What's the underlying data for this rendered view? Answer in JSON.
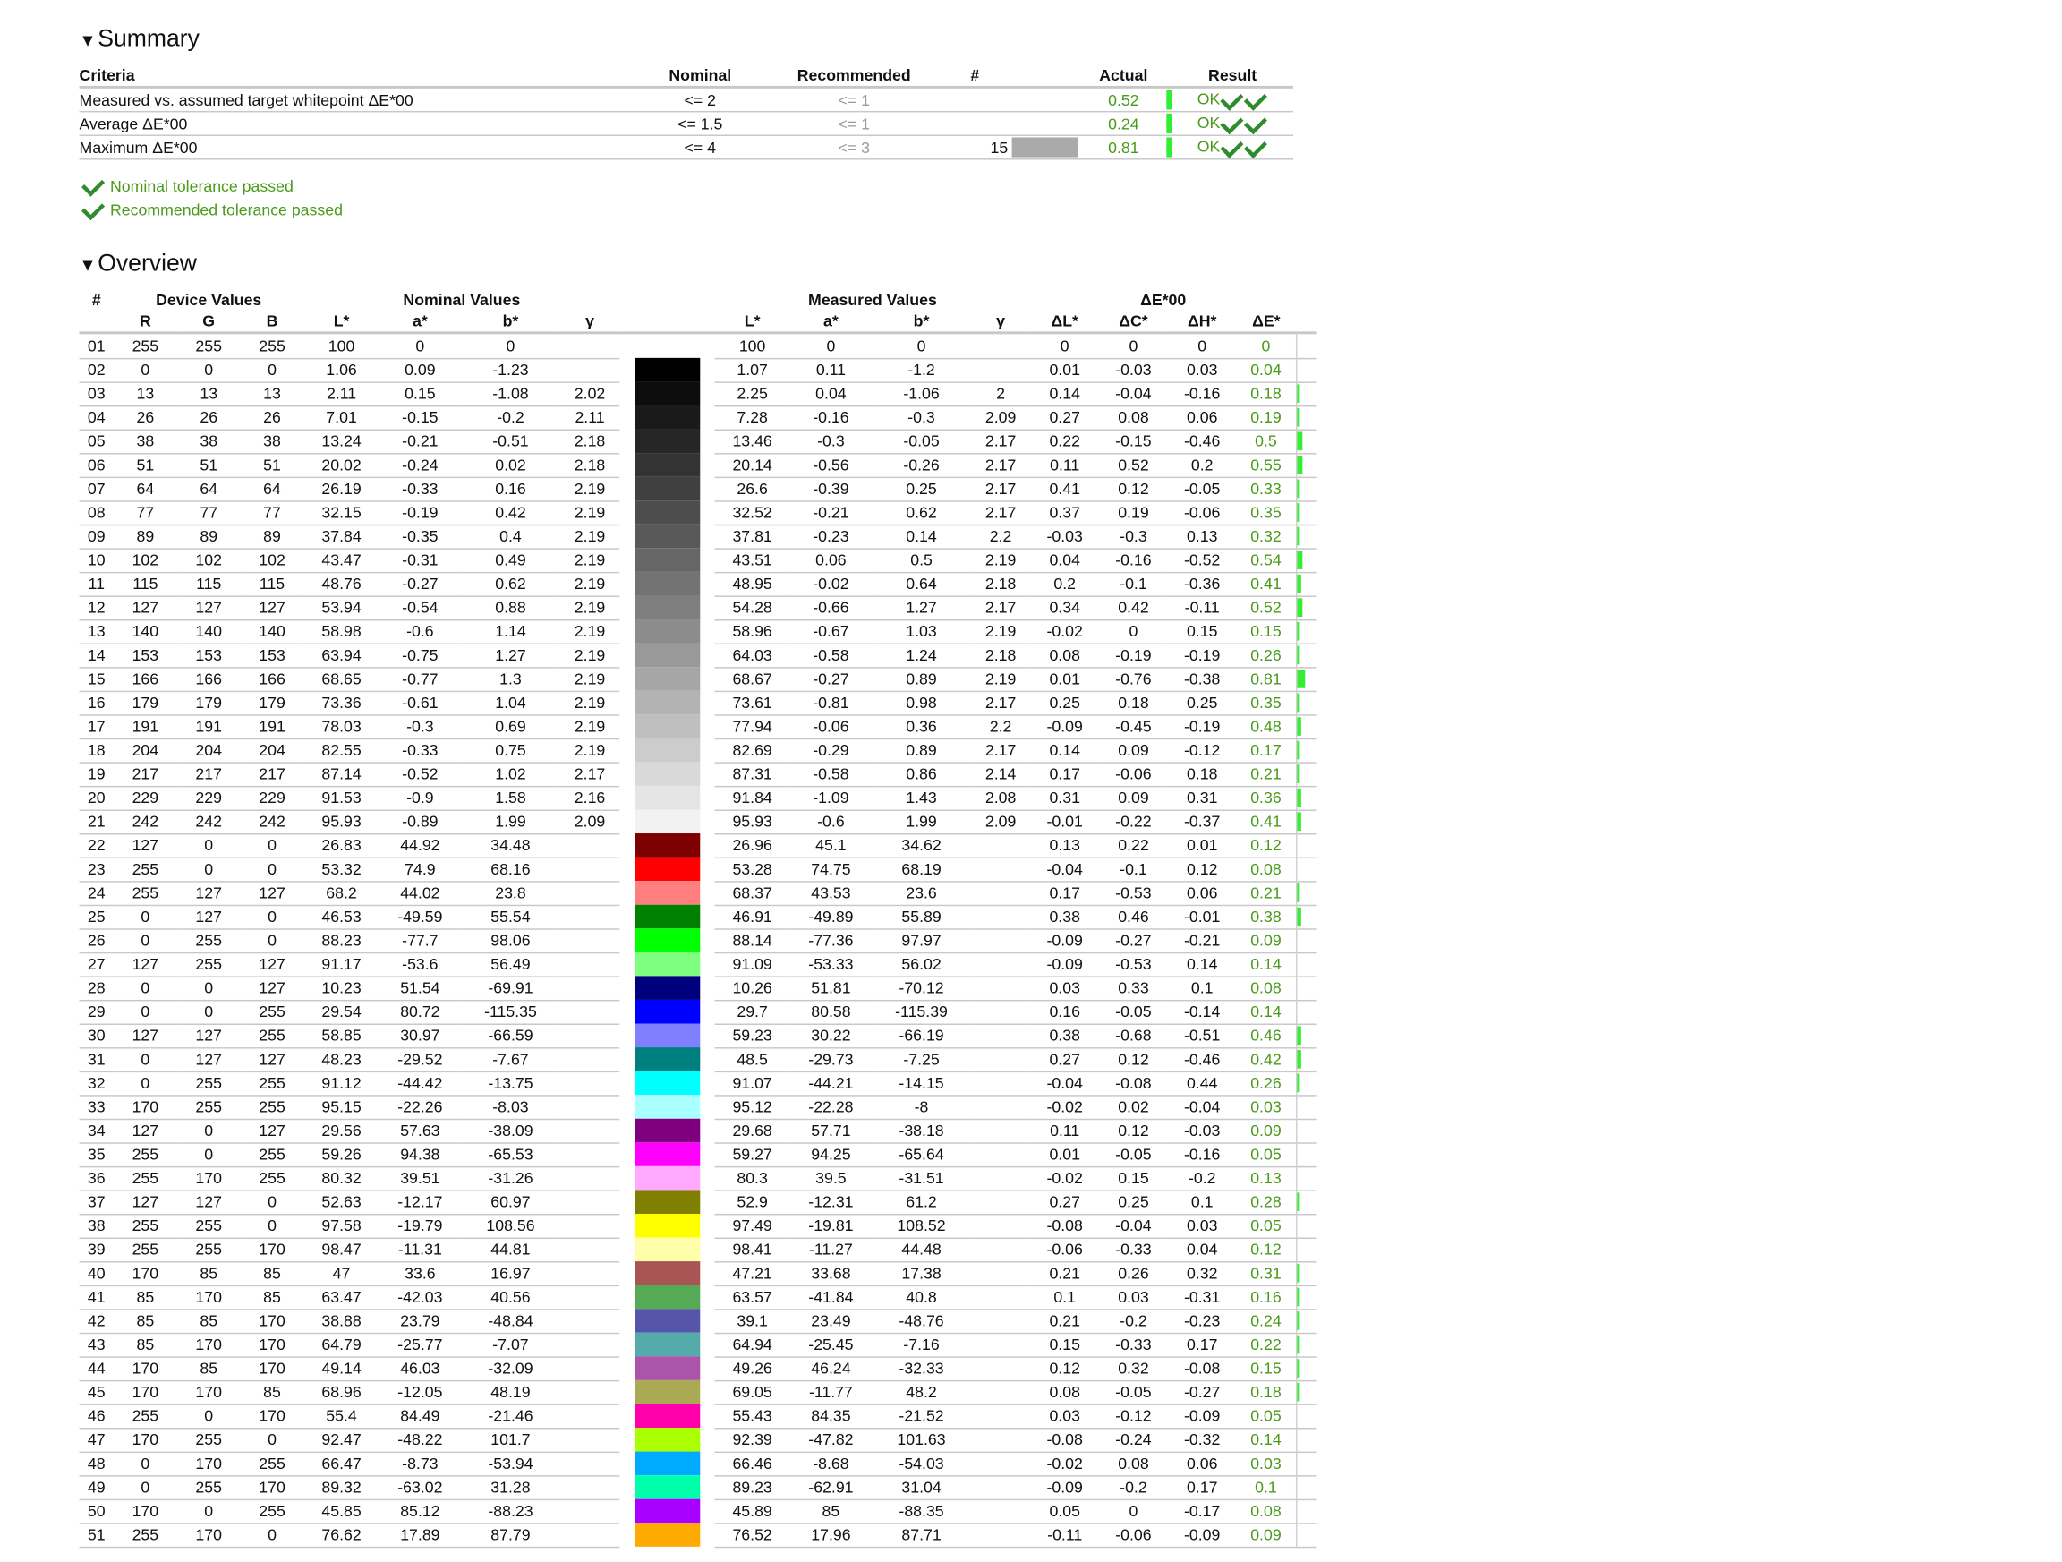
{
  "summary": {
    "title": "Summary",
    "headers": {
      "criteria": "Criteria",
      "nominal": "Nominal",
      "recommended": "Recommended",
      "count": "#",
      "actual": "Actual",
      "result": "Result"
    },
    "rows": [
      {
        "criteria": "Measured vs. assumed target whitepoint ΔE*00",
        "nominal": "<= 2",
        "recommended": "<= 1",
        "count": "",
        "swatch": "",
        "actual": "0.52",
        "bar": 0.52,
        "result": "OK"
      },
      {
        "criteria": "Average ΔE*00",
        "nominal": "<= 1.5",
        "recommended": "<= 1",
        "count": "",
        "swatch": "",
        "actual": "0.24",
        "bar": 0.24,
        "result": "OK"
      },
      {
        "criteria": "Maximum ΔE*00",
        "nominal": "<= 4",
        "recommended": "<= 3",
        "count": "15",
        "swatch": "#aaaaaa",
        "actual": "0.81",
        "bar": 0.81,
        "result": "OK"
      }
    ],
    "passed": [
      "Nominal tolerance passed",
      "Recommended tolerance passed"
    ]
  },
  "overview": {
    "title": "Overview",
    "groups": {
      "num": "#",
      "device": "Device Values",
      "nominal": "Nominal Values",
      "measured": "Measured Values",
      "delta": "ΔE*00"
    },
    "columns": [
      "R",
      "G",
      "B",
      "L*",
      "a*",
      "b*",
      "γ",
      "L*",
      "a*",
      "b*",
      "γ",
      "ΔL*",
      "ΔC*",
      "ΔH*",
      "ΔE*"
    ],
    "rows": [
      [
        "01",
        "255",
        "255",
        "255",
        "100",
        "0",
        "0",
        "",
        "#ffffff",
        "100",
        "0",
        "0",
        "",
        "0",
        "0",
        "0",
        "0"
      ],
      [
        "02",
        "0",
        "0",
        "0",
        "1.06",
        "0.09",
        "-1.23",
        "",
        "#000000",
        "1.07",
        "0.11",
        "-1.2",
        "",
        "0.01",
        "-0.03",
        "0.03",
        "0.04"
      ],
      [
        "03",
        "13",
        "13",
        "13",
        "2.11",
        "0.15",
        "-1.08",
        "2.02",
        "#0d0d0d",
        "2.25",
        "0.04",
        "-1.06",
        "2",
        "0.14",
        "-0.04",
        "-0.16",
        "0.18"
      ],
      [
        "04",
        "26",
        "26",
        "26",
        "7.01",
        "-0.15",
        "-0.2",
        "2.11",
        "#1a1a1a",
        "7.28",
        "-0.16",
        "-0.3",
        "2.09",
        "0.27",
        "0.08",
        "0.06",
        "0.19"
      ],
      [
        "05",
        "38",
        "38",
        "38",
        "13.24",
        "-0.21",
        "-0.51",
        "2.18",
        "#262626",
        "13.46",
        "-0.3",
        "-0.05",
        "2.17",
        "0.22",
        "-0.15",
        "-0.46",
        "0.5"
      ],
      [
        "06",
        "51",
        "51",
        "51",
        "20.02",
        "-0.24",
        "0.02",
        "2.18",
        "#333333",
        "20.14",
        "-0.56",
        "-0.26",
        "2.17",
        "0.11",
        "0.52",
        "0.2",
        "0.55"
      ],
      [
        "07",
        "64",
        "64",
        "64",
        "26.19",
        "-0.33",
        "0.16",
        "2.19",
        "#404040",
        "26.6",
        "-0.39",
        "0.25",
        "2.17",
        "0.41",
        "0.12",
        "-0.05",
        "0.33"
      ],
      [
        "08",
        "77",
        "77",
        "77",
        "32.15",
        "-0.19",
        "0.42",
        "2.19",
        "#4d4d4d",
        "32.52",
        "-0.21",
        "0.62",
        "2.17",
        "0.37",
        "0.19",
        "-0.06",
        "0.35"
      ],
      [
        "09",
        "89",
        "89",
        "89",
        "37.84",
        "-0.35",
        "0.4",
        "2.19",
        "#595959",
        "37.81",
        "-0.23",
        "0.14",
        "2.2",
        "-0.03",
        "-0.3",
        "0.13",
        "0.32"
      ],
      [
        "10",
        "102",
        "102",
        "102",
        "43.47",
        "-0.31",
        "0.49",
        "2.19",
        "#666666",
        "43.51",
        "0.06",
        "0.5",
        "2.19",
        "0.04",
        "-0.16",
        "-0.52",
        "0.54"
      ],
      [
        "11",
        "115",
        "115",
        "115",
        "48.76",
        "-0.27",
        "0.62",
        "2.19",
        "#737373",
        "48.95",
        "-0.02",
        "0.64",
        "2.18",
        "0.2",
        "-0.1",
        "-0.36",
        "0.41"
      ],
      [
        "12",
        "127",
        "127",
        "127",
        "53.94",
        "-0.54",
        "0.88",
        "2.19",
        "#7f7f7f",
        "54.28",
        "-0.66",
        "1.27",
        "2.17",
        "0.34",
        "0.42",
        "-0.11",
        "0.52"
      ],
      [
        "13",
        "140",
        "140",
        "140",
        "58.98",
        "-0.6",
        "1.14",
        "2.19",
        "#8c8c8c",
        "58.96",
        "-0.67",
        "1.03",
        "2.19",
        "-0.02",
        "0",
        "0.15",
        "0.15"
      ],
      [
        "14",
        "153",
        "153",
        "153",
        "63.94",
        "-0.75",
        "1.27",
        "2.19",
        "#999999",
        "64.03",
        "-0.58",
        "1.24",
        "2.18",
        "0.08",
        "-0.19",
        "-0.19",
        "0.26"
      ],
      [
        "15",
        "166",
        "166",
        "166",
        "68.65",
        "-0.77",
        "1.3",
        "2.19",
        "#a6a6a6",
        "68.67",
        "-0.27",
        "0.89",
        "2.19",
        "0.01",
        "-0.76",
        "-0.38",
        "0.81"
      ],
      [
        "16",
        "179",
        "179",
        "179",
        "73.36",
        "-0.61",
        "1.04",
        "2.19",
        "#b3b3b3",
        "73.61",
        "-0.81",
        "0.98",
        "2.17",
        "0.25",
        "0.18",
        "0.25",
        "0.35"
      ],
      [
        "17",
        "191",
        "191",
        "191",
        "78.03",
        "-0.3",
        "0.69",
        "2.19",
        "#bfbfbf",
        "77.94",
        "-0.06",
        "0.36",
        "2.2",
        "-0.09",
        "-0.45",
        "-0.19",
        "0.48"
      ],
      [
        "18",
        "204",
        "204",
        "204",
        "82.55",
        "-0.33",
        "0.75",
        "2.19",
        "#cccccc",
        "82.69",
        "-0.29",
        "0.89",
        "2.17",
        "0.14",
        "0.09",
        "-0.12",
        "0.17"
      ],
      [
        "19",
        "217",
        "217",
        "217",
        "87.14",
        "-0.52",
        "1.02",
        "2.17",
        "#d9d9d9",
        "87.31",
        "-0.58",
        "0.86",
        "2.14",
        "0.17",
        "-0.06",
        "0.18",
        "0.21"
      ],
      [
        "20",
        "229",
        "229",
        "229",
        "91.53",
        "-0.9",
        "1.58",
        "2.16",
        "#e5e5e5",
        "91.84",
        "-1.09",
        "1.43",
        "2.08",
        "0.31",
        "0.09",
        "0.31",
        "0.36"
      ],
      [
        "21",
        "242",
        "242",
        "242",
        "95.93",
        "-0.89",
        "1.99",
        "2.09",
        "#f2f2f2",
        "95.93",
        "-0.6",
        "1.99",
        "2.09",
        "-0.01",
        "-0.22",
        "-0.37",
        "0.41"
      ],
      [
        "22",
        "127",
        "0",
        "0",
        "26.83",
        "44.92",
        "34.48",
        "",
        "#7f0000",
        "26.96",
        "45.1",
        "34.62",
        "",
        "0.13",
        "0.22",
        "0.01",
        "0.12"
      ],
      [
        "23",
        "255",
        "0",
        "0",
        "53.32",
        "74.9",
        "68.16",
        "",
        "#ff0000",
        "53.28",
        "74.75",
        "68.19",
        "",
        "-0.04",
        "-0.1",
        "0.12",
        "0.08"
      ],
      [
        "24",
        "255",
        "127",
        "127",
        "68.2",
        "44.02",
        "23.8",
        "",
        "#ff7f7f",
        "68.37",
        "43.53",
        "23.6",
        "",
        "0.17",
        "-0.53",
        "0.06",
        "0.21"
      ],
      [
        "25",
        "0",
        "127",
        "0",
        "46.53",
        "-49.59",
        "55.54",
        "",
        "#007f00",
        "46.91",
        "-49.89",
        "55.89",
        "",
        "0.38",
        "0.46",
        "-0.01",
        "0.38"
      ],
      [
        "26",
        "0",
        "255",
        "0",
        "88.23",
        "-77.7",
        "98.06",
        "",
        "#00ff00",
        "88.14",
        "-77.36",
        "97.97",
        "",
        "-0.09",
        "-0.27",
        "-0.21",
        "0.09"
      ],
      [
        "27",
        "127",
        "255",
        "127",
        "91.17",
        "-53.6",
        "56.49",
        "",
        "#7fff7f",
        "91.09",
        "-53.33",
        "56.02",
        "",
        "-0.09",
        "-0.53",
        "0.14",
        "0.14"
      ],
      [
        "28",
        "0",
        "0",
        "127",
        "10.23",
        "51.54",
        "-69.91",
        "",
        "#00007f",
        "10.26",
        "51.81",
        "-70.12",
        "",
        "0.03",
        "0.33",
        "0.1",
        "0.08"
      ],
      [
        "29",
        "0",
        "0",
        "255",
        "29.54",
        "80.72",
        "-115.35",
        "",
        "#0000ff",
        "29.7",
        "80.58",
        "-115.39",
        "",
        "0.16",
        "-0.05",
        "-0.14",
        "0.14"
      ],
      [
        "30",
        "127",
        "127",
        "255",
        "58.85",
        "30.97",
        "-66.59",
        "",
        "#7f7fff",
        "59.23",
        "30.22",
        "-66.19",
        "",
        "0.38",
        "-0.68",
        "-0.51",
        "0.46"
      ],
      [
        "31",
        "0",
        "127",
        "127",
        "48.23",
        "-29.52",
        "-7.67",
        "",
        "#007f7f",
        "48.5",
        "-29.73",
        "-7.25",
        "",
        "0.27",
        "0.12",
        "-0.46",
        "0.42"
      ],
      [
        "32",
        "0",
        "255",
        "255",
        "91.12",
        "-44.42",
        "-13.75",
        "",
        "#00ffff",
        "91.07",
        "-44.21",
        "-14.15",
        "",
        "-0.04",
        "-0.08",
        "0.44",
        "0.26"
      ],
      [
        "33",
        "170",
        "255",
        "255",
        "95.15",
        "-22.26",
        "-8.03",
        "",
        "#aaffff",
        "95.12",
        "-22.28",
        "-8",
        "",
        "-0.02",
        "0.02",
        "-0.04",
        "0.03"
      ],
      [
        "34",
        "127",
        "0",
        "127",
        "29.56",
        "57.63",
        "-38.09",
        "",
        "#7f007f",
        "29.68",
        "57.71",
        "-38.18",
        "",
        "0.11",
        "0.12",
        "-0.03",
        "0.09"
      ],
      [
        "35",
        "255",
        "0",
        "255",
        "59.26",
        "94.38",
        "-65.53",
        "",
        "#ff00ff",
        "59.27",
        "94.25",
        "-65.64",
        "",
        "0.01",
        "-0.05",
        "-0.16",
        "0.05"
      ],
      [
        "36",
        "255",
        "170",
        "255",
        "80.32",
        "39.51",
        "-31.26",
        "",
        "#ffaaff",
        "80.3",
        "39.5",
        "-31.51",
        "",
        "-0.02",
        "0.15",
        "-0.2",
        "0.13"
      ],
      [
        "37",
        "127",
        "127",
        "0",
        "52.63",
        "-12.17",
        "60.97",
        "",
        "#7f7f00",
        "52.9",
        "-12.31",
        "61.2",
        "",
        "0.27",
        "0.25",
        "0.1",
        "0.28"
      ],
      [
        "38",
        "255",
        "255",
        "0",
        "97.58",
        "-19.79",
        "108.56",
        "",
        "#ffff00",
        "97.49",
        "-19.81",
        "108.52",
        "",
        "-0.08",
        "-0.04",
        "0.03",
        "0.05"
      ],
      [
        "39",
        "255",
        "255",
        "170",
        "98.47",
        "-11.31",
        "44.81",
        "",
        "#ffffaa",
        "98.41",
        "-11.27",
        "44.48",
        "",
        "-0.06",
        "-0.33",
        "0.04",
        "0.12"
      ],
      [
        "40",
        "170",
        "85",
        "85",
        "47",
        "33.6",
        "16.97",
        "",
        "#aa5555",
        "47.21",
        "33.68",
        "17.38",
        "",
        "0.21",
        "0.26",
        "0.32",
        "0.31"
      ],
      [
        "41",
        "85",
        "170",
        "85",
        "63.47",
        "-42.03",
        "40.56",
        "",
        "#55aa55",
        "63.57",
        "-41.84",
        "40.8",
        "",
        "0.1",
        "0.03",
        "-0.31",
        "0.16"
      ],
      [
        "42",
        "85",
        "85",
        "170",
        "38.88",
        "23.79",
        "-48.84",
        "",
        "#5555aa",
        "39.1",
        "23.49",
        "-48.76",
        "",
        "0.21",
        "-0.2",
        "-0.23",
        "0.24"
      ],
      [
        "43",
        "85",
        "170",
        "170",
        "64.79",
        "-25.77",
        "-7.07",
        "",
        "#55aaaa",
        "64.94",
        "-25.45",
        "-7.16",
        "",
        "0.15",
        "-0.33",
        "0.17",
        "0.22"
      ],
      [
        "44",
        "170",
        "85",
        "170",
        "49.14",
        "46.03",
        "-32.09",
        "",
        "#aa55aa",
        "49.26",
        "46.24",
        "-32.33",
        "",
        "0.12",
        "0.32",
        "-0.08",
        "0.15"
      ],
      [
        "45",
        "170",
        "170",
        "85",
        "68.96",
        "-12.05",
        "48.19",
        "",
        "#aaaa55",
        "69.05",
        "-11.77",
        "48.2",
        "",
        "0.08",
        "-0.05",
        "-0.27",
        "0.18"
      ],
      [
        "46",
        "255",
        "0",
        "170",
        "55.4",
        "84.49",
        "-21.46",
        "",
        "#ff00aa",
        "55.43",
        "84.35",
        "-21.52",
        "",
        "0.03",
        "-0.12",
        "-0.09",
        "0.05"
      ],
      [
        "47",
        "170",
        "255",
        "0",
        "92.47",
        "-48.22",
        "101.7",
        "",
        "#aaff00",
        "92.39",
        "-47.82",
        "101.63",
        "",
        "-0.08",
        "-0.24",
        "-0.32",
        "0.14"
      ],
      [
        "48",
        "0",
        "170",
        "255",
        "66.47",
        "-8.73",
        "-53.94",
        "",
        "#00aaff",
        "66.46",
        "-8.68",
        "-54.03",
        "",
        "-0.02",
        "0.08",
        "0.06",
        "0.03"
      ],
      [
        "49",
        "0",
        "255",
        "170",
        "89.32",
        "-63.02",
        "31.28",
        "",
        "#00ffaa",
        "89.23",
        "-62.91",
        "31.04",
        "",
        "-0.09",
        "-0.2",
        "0.17",
        "0.1"
      ],
      [
        "50",
        "170",
        "0",
        "255",
        "45.85",
        "85.12",
        "-88.23",
        "",
        "#aa00ff",
        "45.89",
        "85",
        "-88.35",
        "",
        "0.05",
        "0",
        "-0.17",
        "0.08"
      ],
      [
        "51",
        "255",
        "170",
        "0",
        "76.62",
        "17.89",
        "87.79",
        "",
        "#ffaa00",
        "76.52",
        "17.96",
        "87.71",
        "",
        "-0.11",
        "-0.06",
        "-0.09",
        "0.09"
      ]
    ]
  }
}
